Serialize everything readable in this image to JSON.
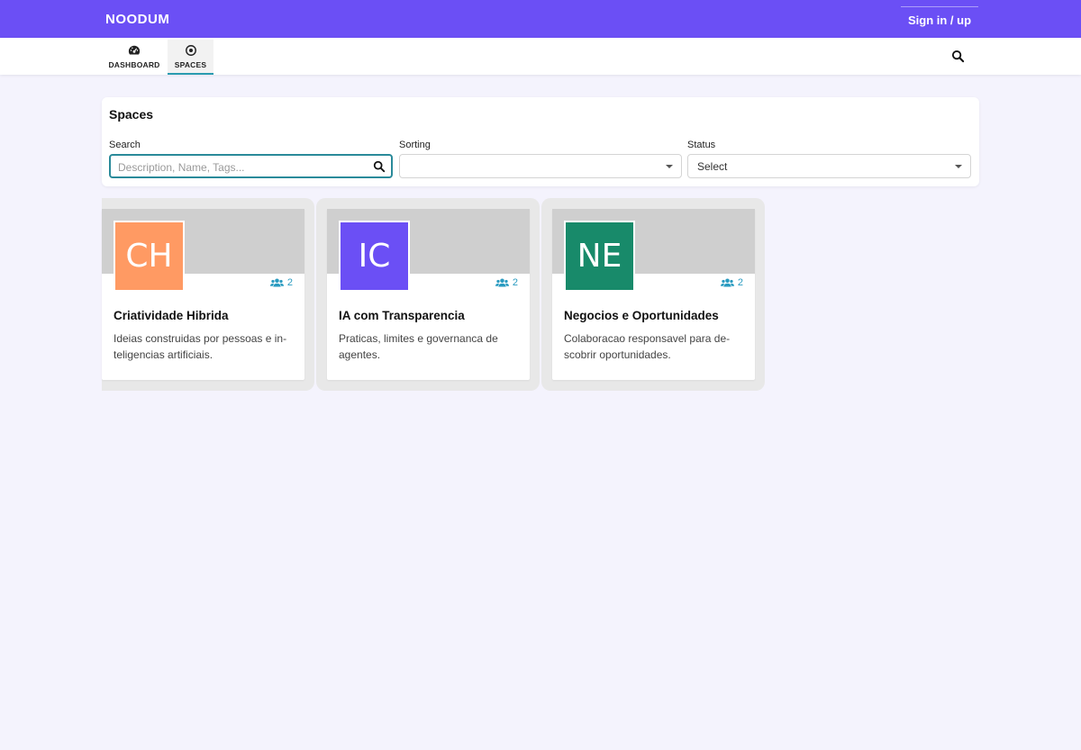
{
  "topbar": {
    "brand": "NOODUM",
    "signin_label": "Sign in / up",
    "color": "#6b4ff5"
  },
  "nav": {
    "items": [
      {
        "label": "DASHBOARD",
        "icon": "dashboard-gauge-icon",
        "active": false
      },
      {
        "label": "SPACES",
        "icon": "spaces-target-icon",
        "active": true
      }
    ],
    "search_icon": "search-icon"
  },
  "filters": {
    "title": "Spaces",
    "search": {
      "label": "Search",
      "placeholder": "Description, Name, Tags...",
      "value": ""
    },
    "sorting": {
      "label": "Sorting",
      "value": ""
    },
    "status": {
      "label": "Status",
      "value": "Select"
    }
  },
  "spaces": [
    {
      "initials": "CH",
      "color": "#ff9a63",
      "members": "2",
      "title": "Criatividade Hibrida",
      "description": "Ideias construidas por pessoas e in-teligencias artificiais."
    },
    {
      "initials": "IC",
      "color": "#6b4ff5",
      "members": "2",
      "title": "IA com Transparencia",
      "description": "Praticas, limites e governanca de agentes."
    },
    {
      "initials": "NE",
      "color": "#188a6a",
      "members": "2",
      "title": "Negocios e Oportunidades",
      "description": "Colaboracao responsavel para de-scobrir oportunidades."
    }
  ]
}
